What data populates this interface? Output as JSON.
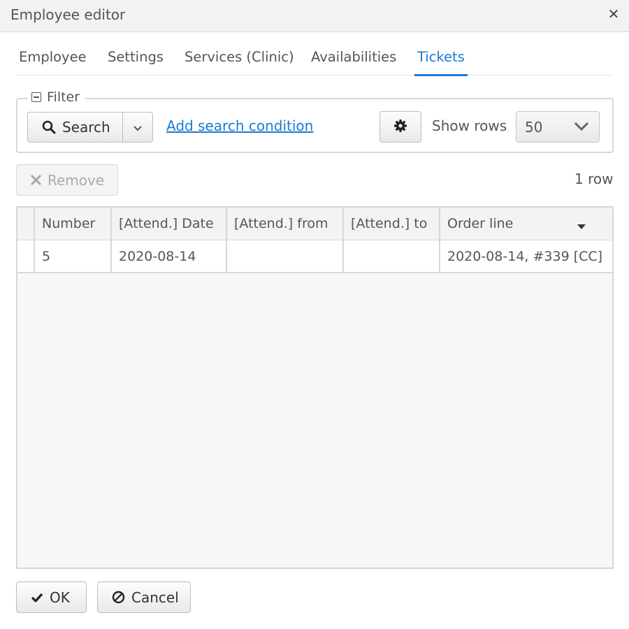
{
  "window": {
    "title": "Employee editor",
    "close_icon": "close-icon"
  },
  "tabs": [
    {
      "label": "Employee",
      "active": false
    },
    {
      "label": "Settings",
      "active": false
    },
    {
      "label": "Services (Clinic)",
      "active": false
    },
    {
      "label": "Availabilities",
      "active": false
    },
    {
      "label": "Tickets",
      "active": true
    }
  ],
  "filter": {
    "legend": "Filter",
    "search_label": "Search",
    "add_condition_label": "Add search condition",
    "show_rows_label": "Show rows",
    "rows_value": "50"
  },
  "toolbar": {
    "remove_label": "Remove",
    "row_count": "1 row"
  },
  "table": {
    "columns": [
      "Number",
      "[Attend.] Date",
      "[Attend.] from",
      "[Attend.] to",
      "Order line"
    ],
    "sorted_column": "Order line",
    "rows": [
      [
        "5",
        "2020-08-14",
        "",
        "",
        "2020-08-14, #339 [CC]"
      ]
    ]
  },
  "footer": {
    "ok_label": "OK",
    "cancel_label": "Cancel"
  },
  "colors": {
    "accent": "#1a7ad4",
    "border": "#d7d7d7"
  }
}
